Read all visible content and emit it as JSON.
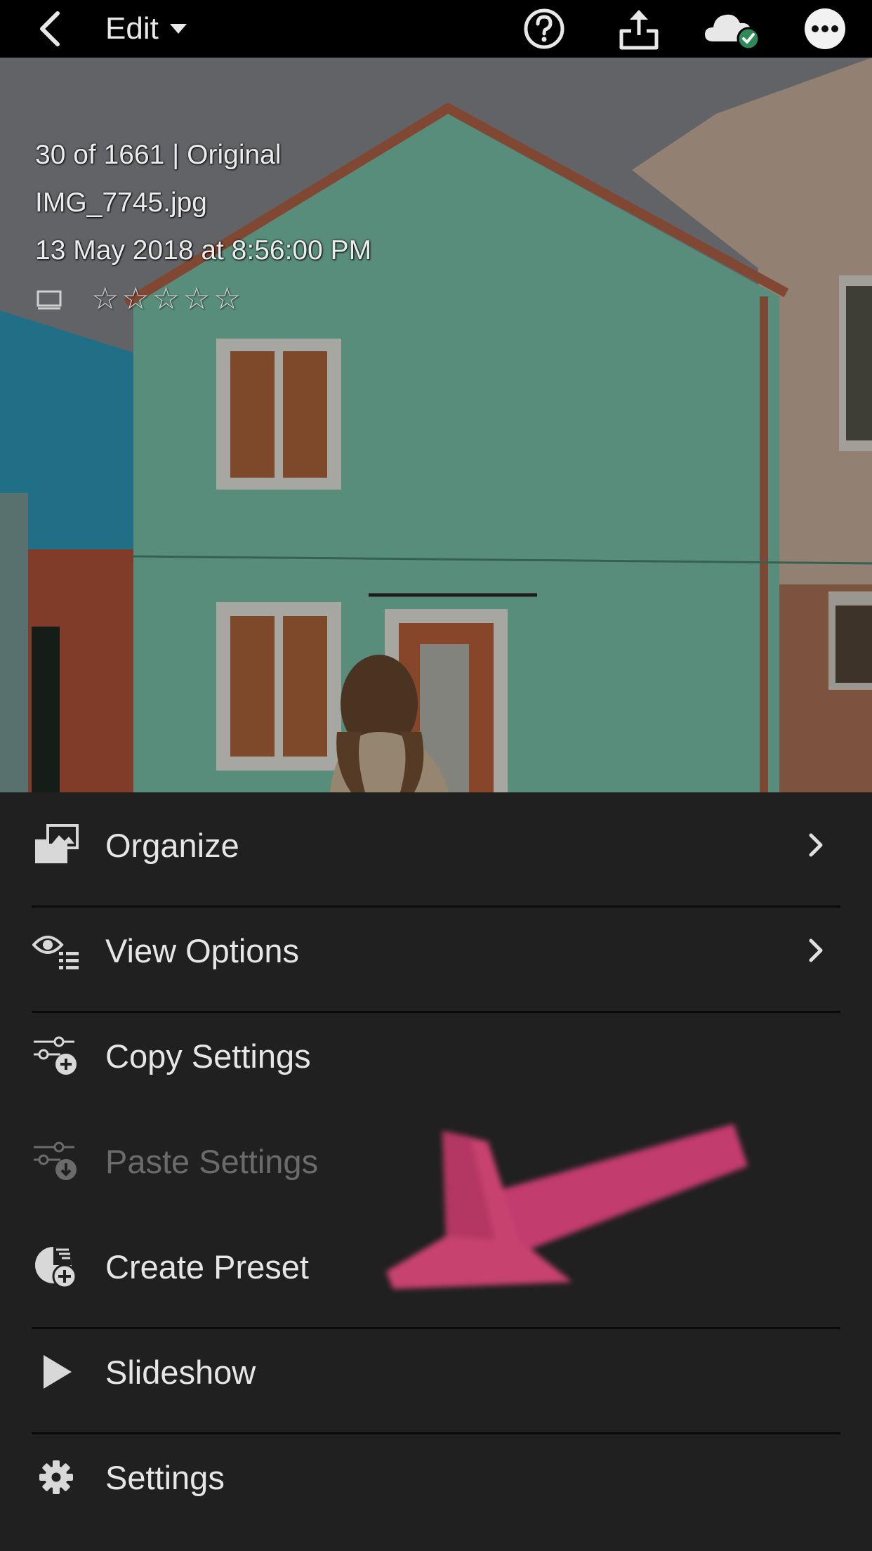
{
  "topbar": {
    "edit_label": "Edit"
  },
  "photo_info": {
    "counter": "30 of 1661 | Original",
    "filename": "IMG_7745.jpg",
    "datetime": "13 May 2018 at 8:56:00 PM",
    "stars": [
      "☆",
      "☆",
      "☆",
      "☆",
      "☆"
    ]
  },
  "menu": {
    "items": [
      {
        "label": "Organize",
        "icon": "folder-images-icon",
        "chevron": true,
        "enabled": true
      },
      {
        "label": "View Options",
        "icon": "eye-list-icon",
        "chevron": true,
        "enabled": true
      },
      {
        "label": "Copy Settings",
        "icon": "sliders-plus-icon",
        "chevron": false,
        "enabled": true
      },
      {
        "label": "Paste Settings",
        "icon": "sliders-download-icon",
        "chevron": false,
        "enabled": false
      },
      {
        "label": "Create Preset",
        "icon": "preset-plus-icon",
        "chevron": false,
        "enabled": true
      },
      {
        "label": "Slideshow",
        "icon": "play-icon",
        "chevron": false,
        "enabled": true
      },
      {
        "label": "Settings",
        "icon": "gear-icon",
        "chevron": false,
        "enabled": true
      }
    ]
  },
  "colors": {
    "menu_bg": "#202020",
    "text": "#e6e6e6",
    "disabled_text": "#6b6b6b",
    "annotation_pink": "#e0467a",
    "cloud_check": "#2e8b57"
  }
}
